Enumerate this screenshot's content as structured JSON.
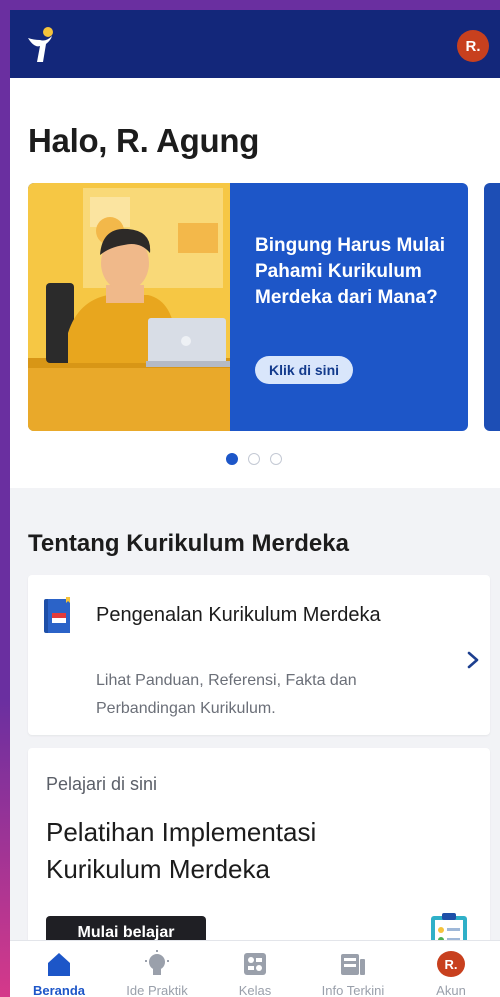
{
  "header": {
    "avatar_initial": "R."
  },
  "greeting": "Halo, R. Agung",
  "banner": {
    "title": "Bingung Harus Mulai Pahami Kurikulum Merdeka dari Mana?",
    "cta_label": "Klik di sini",
    "slides_total": 3,
    "active_slide": 1
  },
  "section": {
    "title": "Tentang Kurikulum Merdeka",
    "card1": {
      "title": "Pengenalan Kurikulum Merdeka",
      "description": "Lihat Panduan, Referensi, Fakta dan Perbandingan Kurikulum."
    },
    "card2": {
      "eyebrow": "Pelajari di sini",
      "title": "Pelatihan Implementasi Kurikulum Merdeka",
      "button_label": "Mulai belajar"
    }
  },
  "nav": {
    "items": [
      {
        "label": "Beranda",
        "icon": "home-icon",
        "active": true
      },
      {
        "label": "Ide Praktik",
        "icon": "lightbulb-icon",
        "active": false
      },
      {
        "label": "Kelas",
        "icon": "class-icon",
        "active": false
      },
      {
        "label": "Info Terkini",
        "icon": "news-icon",
        "active": false
      },
      {
        "label": "Akun",
        "icon": "avatar",
        "active": false,
        "avatar_initial": "R."
      }
    ]
  },
  "colors": {
    "header_bg": "#13277a",
    "accent": "#1d56c8",
    "avatar_bg": "#c8401e",
    "banner_illustration_bg": "#f6c744"
  }
}
